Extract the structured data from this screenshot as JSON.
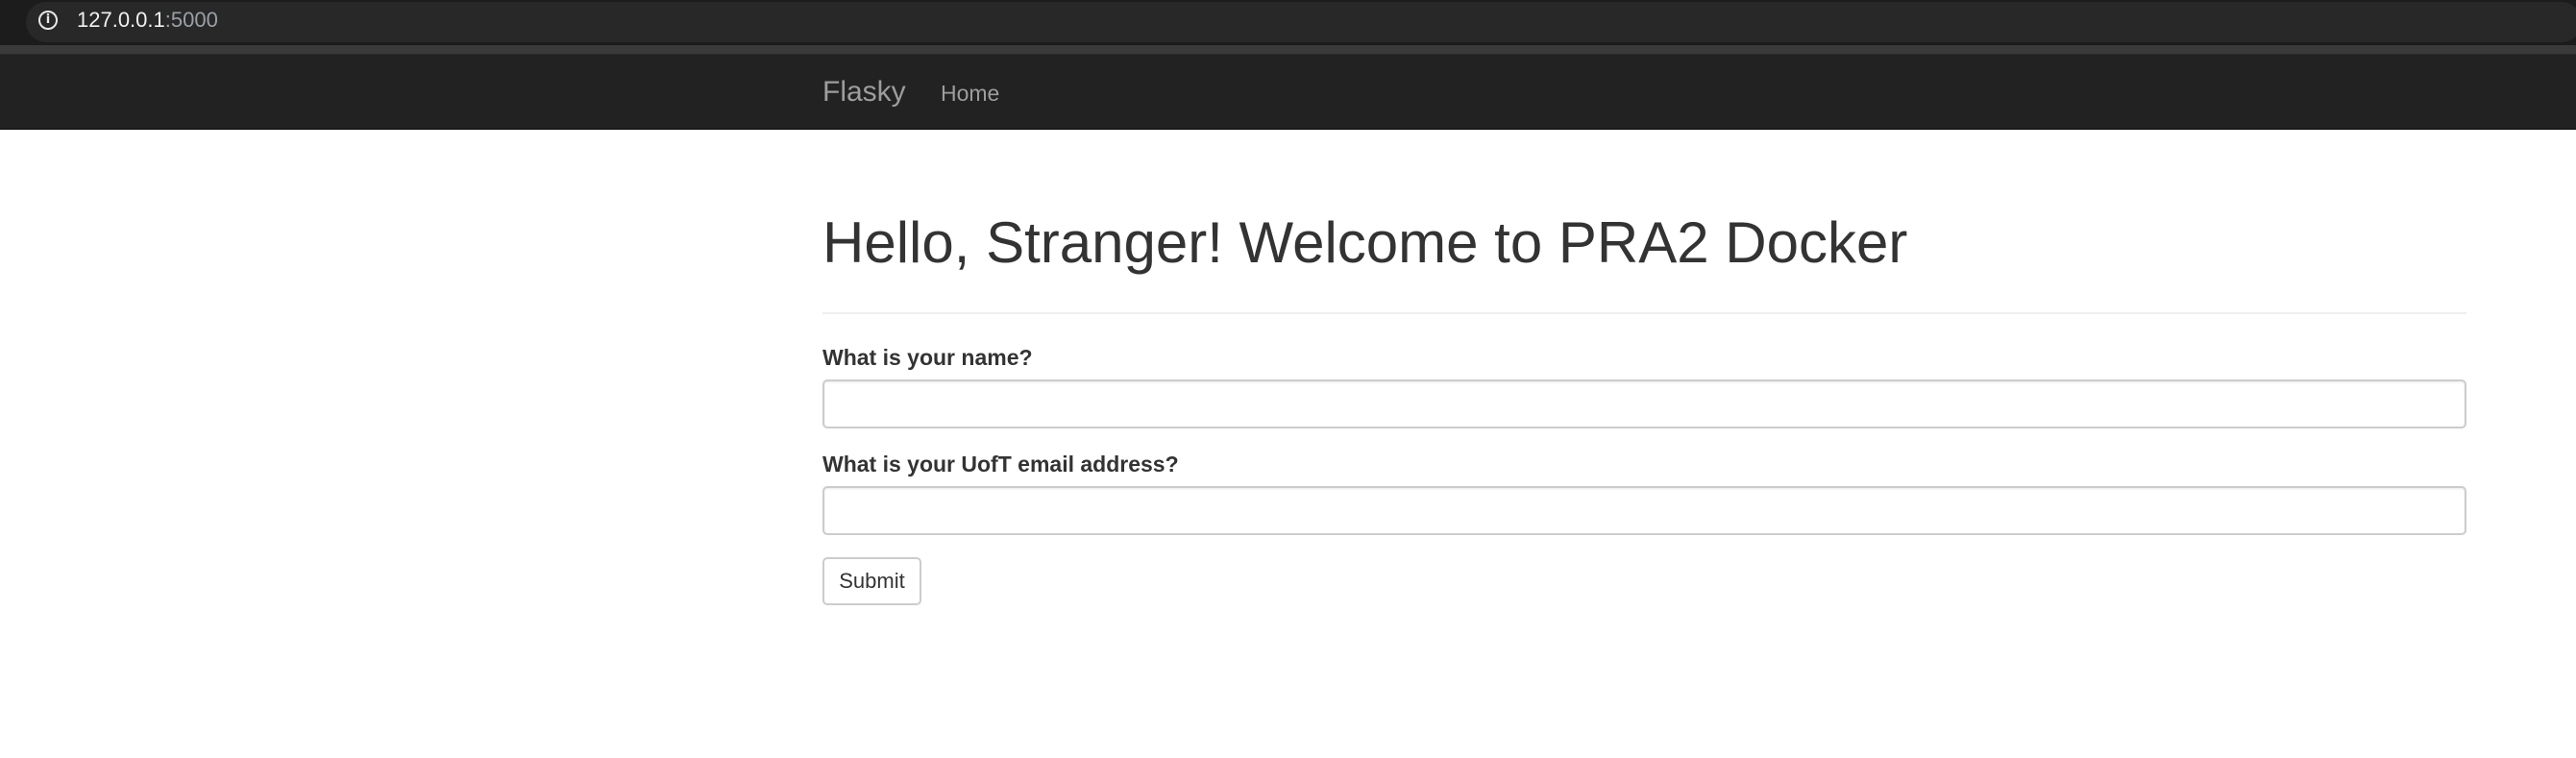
{
  "browser": {
    "url_host": "127.0.0.1",
    "url_port": ":5000",
    "info_icon": "info-icon"
  },
  "navbar": {
    "brand": "Flasky",
    "links": [
      {
        "label": "Home"
      }
    ],
    "background": "#222222",
    "link_color": "#9d9d9d"
  },
  "page": {
    "title": "Hello, Stranger! Welcome to PRA2 Docker"
  },
  "form": {
    "name_label": "What is your name?",
    "name_value": "",
    "email_label": "What is your UofT email address?",
    "email_value": "",
    "submit_label": "Submit"
  }
}
